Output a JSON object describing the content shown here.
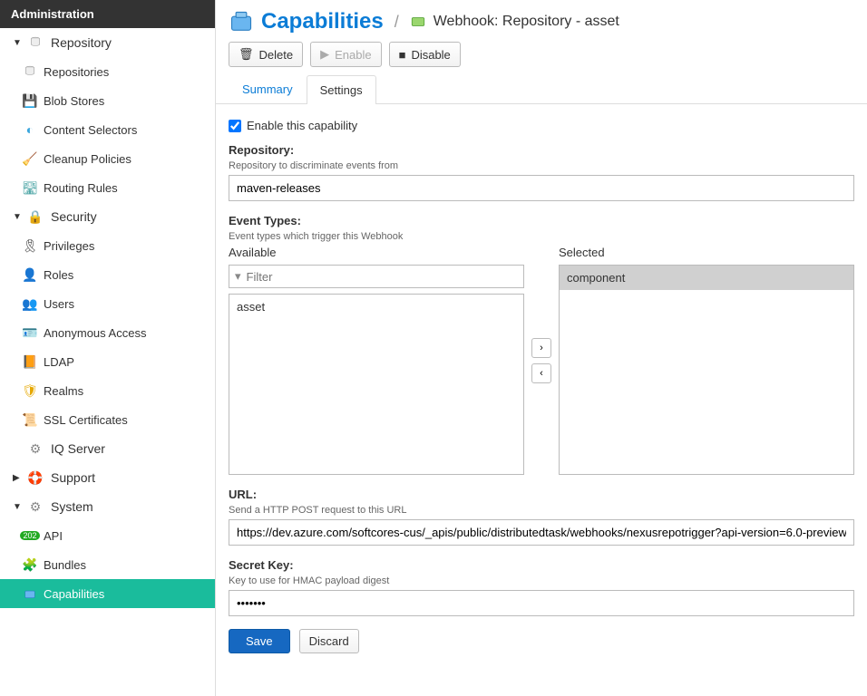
{
  "sidebar": {
    "header": "Administration",
    "groups": [
      {
        "label": "Repository",
        "expanded": true,
        "icon": "database",
        "children": [
          {
            "label": "Repositories",
            "icon": "database"
          },
          {
            "label": "Blob Stores",
            "icon": "blob"
          },
          {
            "label": "Content Selectors",
            "icon": "selector"
          },
          {
            "label": "Cleanup Policies",
            "icon": "broom"
          },
          {
            "label": "Routing Rules",
            "icon": "route"
          }
        ]
      },
      {
        "label": "Security",
        "expanded": true,
        "icon": "lock",
        "children": [
          {
            "label": "Privileges",
            "icon": "ribbon"
          },
          {
            "label": "Roles",
            "icon": "user-role"
          },
          {
            "label": "Users",
            "icon": "users"
          },
          {
            "label": "Anonymous Access",
            "icon": "id-card"
          },
          {
            "label": "LDAP",
            "icon": "book"
          },
          {
            "label": "Realms",
            "icon": "shield"
          },
          {
            "label": "SSL Certificates",
            "icon": "certificate"
          }
        ]
      },
      {
        "label": "IQ Server",
        "expanded": false,
        "icon": "iq",
        "children": []
      },
      {
        "label": "Support",
        "expanded": false,
        "icon": "support",
        "collapsedCaret": true,
        "children": []
      },
      {
        "label": "System",
        "expanded": true,
        "icon": "gear",
        "children": [
          {
            "label": "API",
            "icon": "badge"
          },
          {
            "label": "Bundles",
            "icon": "puzzle"
          },
          {
            "label": "Capabilities",
            "icon": "box",
            "active": true
          }
        ]
      }
    ]
  },
  "header": {
    "title": "Capabilities",
    "breadcrumbSep": "/",
    "subtitle": "Webhook: Repository - asset"
  },
  "toolbar": {
    "delete": "Delete",
    "enable": "Enable",
    "disable": "Disable"
  },
  "tabs": {
    "summary": "Summary",
    "settings": "Settings",
    "active": "settings"
  },
  "form": {
    "enable_checkbox_label": "Enable this capability",
    "enable_checked": true,
    "repository": {
      "label": "Repository:",
      "desc": "Repository to discriminate events from",
      "value": "maven-releases"
    },
    "event_types": {
      "label": "Event Types:",
      "desc": "Event types which trigger this Webhook",
      "available_label": "Available",
      "selected_label": "Selected",
      "filter_placeholder": "Filter",
      "available": [
        "asset"
      ],
      "selected": [
        "component"
      ]
    },
    "url": {
      "label": "URL:",
      "desc": "Send a HTTP POST request to this URL",
      "value": "https://dev.azure.com/softcores-cus/_apis/public/distributedtask/webhooks/nexusrepotrigger?api-version=6.0-preview"
    },
    "secret": {
      "label": "Secret Key:",
      "desc": "Key to use for HMAC payload digest",
      "value": "•••••••"
    },
    "save": "Save",
    "discard": "Discard"
  },
  "icons": {
    "delete": "🗑",
    "enable": "▶",
    "disable": "■",
    "filter": "⧩",
    "chevron_right": "›",
    "chevron_left": "‹",
    "caret_down": "▼",
    "caret_right": "▶"
  }
}
